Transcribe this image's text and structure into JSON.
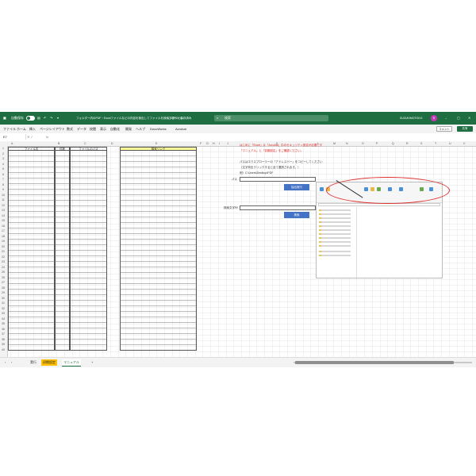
{
  "title_bar": {
    "autosave_label": "自動保存",
    "autosave_state": "オフ",
    "document_title": "フォルダー内のPDF・Excelファイルなどの内容を検出してファイルを検索するツール - ",
    "location": "このPCに保存済み",
    "search_placeholder": "検索",
    "user_name": "SUZUKIMOTOKO",
    "avatar_initial": "S",
    "accent_color": "#1e6e42"
  },
  "menu": {
    "items": [
      "ファイル",
      "ホーム",
      "挿入",
      "ページレイアウト",
      "数式",
      "データ",
      "校閲",
      "表示",
      "自動化",
      "開発",
      "ヘルプ",
      "DocuWorks",
      "Acrobat"
    ],
    "comment_label": "コメント",
    "share_label": "共有"
  },
  "formula_bar": {
    "cell_ref": "E7",
    "fx_symbol": "fx",
    "value": ""
  },
  "sheet": {
    "column_letters": [
      "A",
      "B",
      "C",
      "D",
      "E",
      "F",
      "G",
      "H",
      "I",
      "J",
      "K",
      "L",
      "M",
      "N",
      "O",
      "P",
      "Q",
      "R",
      "S",
      "T",
      "U",
      "V",
      "W",
      "X",
      "Y",
      "Z",
      "AA",
      "AB"
    ],
    "row_count": 40,
    "headers": {
      "file_name": "ファイル名",
      "extension": "件数",
      "file_path": "ファイルのパス",
      "search_link": "検索リンク"
    },
    "notes": {
      "red_line": "はじめに「Excel」＆「Acrobat」中のセキュリティ設定が必要です",
      "red_line2": "「マニュアル」と「初期設定」をご確認ください。",
      "blue_line1": "パスはエクスプローラーの「アドレスバー」をコピーしてください",
      "blue_line2": "（文字列をクリックすると全て選択されます。）",
      "blue_line3": "例）C:\\Users\\Desktop\\PDF"
    },
    "path_label": "パス",
    "run_button": "抽出実行",
    "keyword_label": "検索文字列",
    "search_button": "検索"
  },
  "tabs": {
    "items": [
      {
        "label": "実行",
        "style": "plain"
      },
      {
        "label": "初期設定",
        "style": "yellow"
      },
      {
        "label": "マニュアル",
        "style": "active"
      }
    ],
    "add_label": "+"
  }
}
